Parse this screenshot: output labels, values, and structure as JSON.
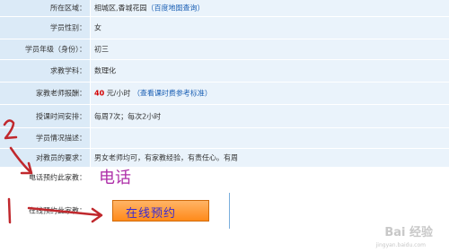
{
  "rows": [
    {
      "label": "所在区域：",
      "value": "相城区,香城花园",
      "link": "（百度地图查询）"
    },
    {
      "label": "学员性别：",
      "value": "女"
    },
    {
      "label": "学员年级（身份）：",
      "value": "初三"
    },
    {
      "label": "求教学科：",
      "value": "数理化"
    },
    {
      "label": "家教老师报酬：",
      "price": "40",
      "unit": "元/小时",
      "link": "（查看课时费参考标准）"
    },
    {
      "label": "授课时间安排：",
      "value": "每周7次；每次2小时"
    },
    {
      "label": "学员情况描述：",
      "value": ""
    },
    {
      "label": "对教员的要求：",
      "value": "男女老师均可，有家教经验，有责任心。有周"
    },
    {
      "label": "电话预约此家教：",
      "value": ""
    },
    {
      "label": "在线预约此家教：",
      "value": ""
    }
  ],
  "handwriting": {
    "phone": "电话",
    "num2": "2",
    "num1": "1"
  },
  "button": {
    "label": "在线预约"
  },
  "watermark": {
    "main": "Bai 经验",
    "sub": "jingyan.baidu.com"
  },
  "colors": {
    "label_bg": "#dbeaf7",
    "value_bg": "#eaf3fb",
    "annotation": "#c0282d",
    "link": "#1a5fb4"
  }
}
